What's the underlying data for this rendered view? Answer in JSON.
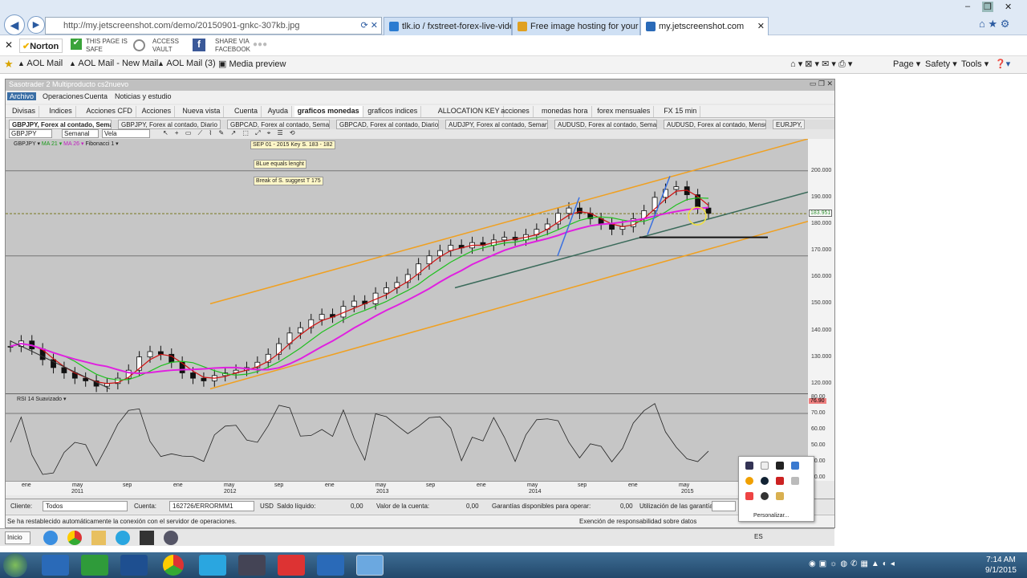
{
  "browser": {
    "url": "http://my.jetscreenshot.com/demo/20150901-gnkc-307kb.jpg",
    "tabs": [
      {
        "label": "tlk.io / fxstreet-forex-live-video",
        "active": false,
        "color": "#2b7bd1"
      },
      {
        "label": "Free image hosting for your sc...",
        "active": false,
        "color": "#e0a020"
      },
      {
        "label": "my.jetscreenshot.com",
        "active": true,
        "color": "#2a6ab8"
      }
    ],
    "window_controls": {
      "minimize": "–",
      "restore": "❐",
      "close": "✕"
    }
  },
  "norton": {
    "brand": "Norton",
    "safe_line1": "THIS PAGE IS",
    "safe_line2": "SAFE",
    "vault_line1": "ACCESS",
    "vault_line2": "VAULT",
    "share_line1": "SHARE VIA",
    "share_line2": "FACEBOOK"
  },
  "favorites": {
    "items": [
      "AOL Mail",
      "AOL Mail - New Mail",
      "AOL Mail (3)",
      "Media preview"
    ],
    "commands": [
      "Page ▾",
      "Safety ▾",
      "Tools ▾"
    ]
  },
  "app": {
    "title": "Sasotrader 2   Multiproducto cs2nuevo",
    "menu": [
      "Archivo",
      "Operaciones",
      "Cuenta",
      "Noticias y estudio"
    ],
    "tabs": [
      "Divisas",
      "Indices",
      "Acciones CFD",
      "Acciones",
      "Nueva vista",
      "Cuenta",
      "Ayuda",
      "graficos monedas",
      "graficos indices",
      "ALLOCATION KEY",
      "acciones",
      "monedas hora",
      "forex mensuales",
      "FX 15 min"
    ],
    "active_tab": "graficos monedas",
    "chart_tabs": [
      {
        "label": "GBPJPY, Forex al contado, Semanal",
        "active": true
      },
      {
        "label": "GBPJPY, Forex al contado, Diario",
        "active": false
      },
      {
        "label": "GBPCAD, Forex al contado, Semanal",
        "active": false
      },
      {
        "label": "GBPCAD, Forex al contado, Diario",
        "active": false
      },
      {
        "label": "AUDJPY, Forex al contado, Semanal",
        "active": false
      },
      {
        "label": "AUDUSD, Forex al contado, Semanal",
        "active": false
      },
      {
        "label": "AUDUSD, Forex al contado, Mensual",
        "active": false
      },
      {
        "label": "EURJPY,",
        "active": false
      }
    ],
    "toolbar": {
      "symbol": "GBPJPY",
      "period": "Semanal",
      "chart_type": "Vela"
    },
    "indicator_line": {
      "symbol": "GBPJPY ▾",
      "ma21": "MA 21 ▾",
      "ma26": "MA 26 ▾",
      "fib": "Fibonacci 1 ▾"
    },
    "annotations": [
      "SEP 01 - 2015 Key S. 183 - 182",
      "BLue equals lenght",
      "Break of S. suggest T 175"
    ],
    "rsi_label": "RSI 14 Suavizado ▾",
    "rsi_value": "76.90",
    "price_label": "183.951",
    "account": {
      "cliente_label": "Cliente:",
      "cliente_value": "Todos",
      "cuenta_label": "Cuenta:",
      "cuenta_value": "162726/ERRORMM1",
      "currency": "USD",
      "saldo_label": "Saldo líquido:",
      "saldo_value": "0,00",
      "valor_label": "Valor de la cuenta:",
      "valor_value": "0,00",
      "garantias_label": "Garantías disponibles para operar:",
      "garantias_value": "0,00",
      "util_label": "Utilización de las garantías:"
    },
    "status": "Se ha restablecido automáticamente la conexión con el servidor de operaciones.",
    "disclaimer": "Exención de responsabilidad sobre datos"
  },
  "chart_data": {
    "type": "candlestick",
    "price_axis": {
      "ticks": [
        "200.000",
        "190.000",
        "180.000",
        "170.000",
        "160.000",
        "150.000",
        "140.000",
        "130.000",
        "120.000"
      ],
      "range": [
        116,
        212
      ]
    },
    "rsi_axis": {
      "ticks": [
        "80.00",
        "70.00",
        "60.00",
        "50.00",
        "40.00",
        "30.00"
      ],
      "range": [
        28,
        82
      ]
    },
    "time_axis": [
      {
        "label": "ene",
        "year": ""
      },
      {
        "label": "may",
        "year": ""
      },
      {
        "label": "sep",
        "year": ""
      },
      {
        "label": "ene",
        "year": ""
      },
      {
        "label": "may",
        "year": ""
      },
      {
        "label": "sep",
        "year": ""
      },
      {
        "label": "ene",
        "year": ""
      },
      {
        "label": "may",
        "year": ""
      },
      {
        "label": "sep",
        "year": ""
      },
      {
        "label": "ene",
        "year": ""
      },
      {
        "label": "may",
        "year": ""
      },
      {
        "label": "sep",
        "year": ""
      },
      {
        "label": "ene",
        "year": ""
      },
      {
        "label": "may",
        "year": ""
      }
    ],
    "years": [
      "2011",
      "2012",
      "2013",
      "2014",
      "2015"
    ],
    "close_series": [
      134,
      136,
      133,
      129,
      126,
      124,
      122,
      121,
      119,
      120,
      122,
      125,
      130,
      132,
      131,
      128,
      124,
      122,
      121,
      123,
      124,
      125,
      126,
      128,
      131,
      135,
      139,
      141,
      144,
      146,
      145,
      149,
      151,
      150,
      154,
      156,
      158,
      161,
      165,
      168,
      170,
      172,
      171,
      173,
      172,
      174,
      175,
      174,
      176,
      178,
      180,
      184,
      186,
      184,
      182,
      180,
      178,
      179,
      182,
      185,
      190,
      193,
      194,
      191,
      186,
      184
    ]
  },
  "system_tray": {
    "lang": "ES",
    "time": "7:14 AM",
    "date": "9/1/2015",
    "start": "Inicio",
    "personalize": "Personalizar..."
  }
}
